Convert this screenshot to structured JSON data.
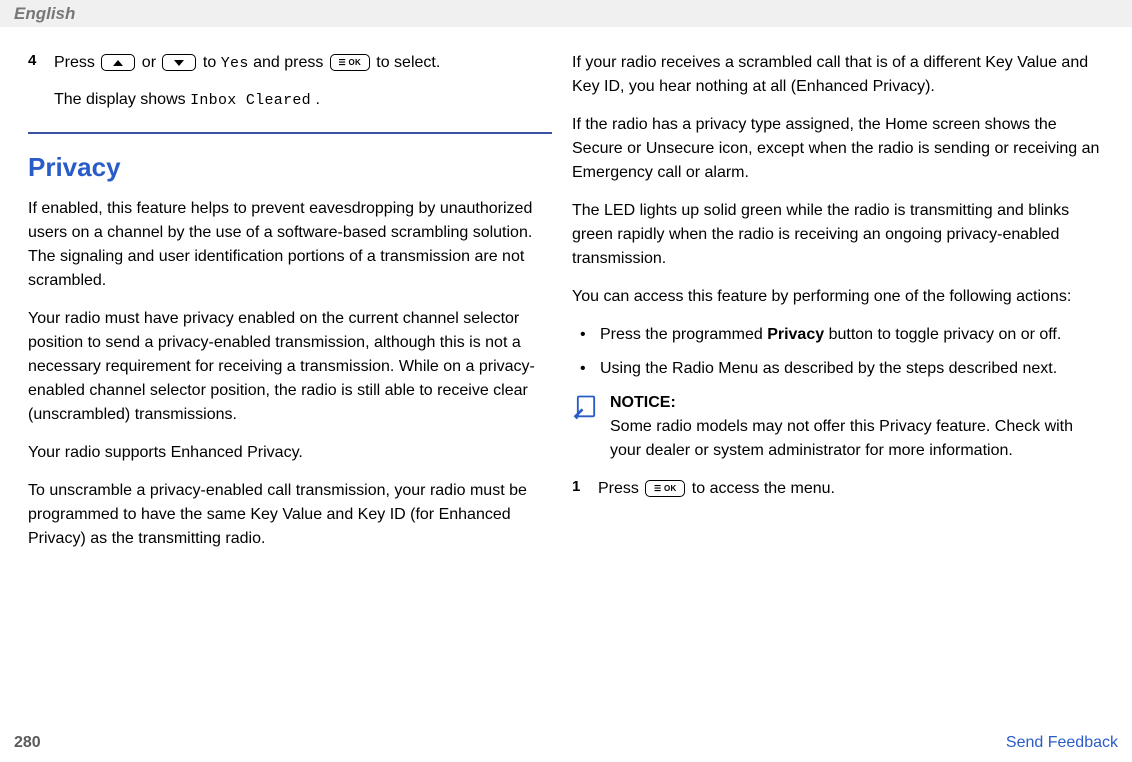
{
  "header": {
    "language": "English"
  },
  "left": {
    "step4": {
      "num": "4",
      "line1_a": "Press ",
      "line1_b": " or ",
      "line1_c": " to ",
      "yes": "Yes",
      "line1_d": " and press ",
      "line1_e": " to select.",
      "line2_a": "The display shows ",
      "inbox_cleared": "Inbox Cleared",
      "line2_b": "."
    },
    "privacy_heading": "Privacy",
    "p1": "If enabled, this feature helps to prevent eavesdropping by unauthorized users on a channel by the use of a software-based scrambling solution. The signaling and user identification portions of a transmission are not scrambled.",
    "p2": "Your radio must have privacy enabled on the current channel selector position to send a privacy-enabled transmission, although this is not a necessary requirement for receiving a transmission. While on a privacy-enabled channel selector position, the radio is still able to receive clear (unscrambled) transmissions.",
    "p3": "Your radio supports Enhanced Privacy.",
    "p4": "To unscramble a privacy-enabled call transmission, your radio must be programmed to have the same Key Value and Key ID (for Enhanced Privacy) as the transmitting radio."
  },
  "right": {
    "p1": "If your radio receives a scrambled call that is of a different Key Value and Key ID, you hear nothing at all (Enhanced Privacy).",
    "p2": "If the radio has a privacy type assigned, the Home screen shows the Secure or Unsecure icon, except when the radio is sending or receiving an Emergency call or alarm.",
    "p3": "The LED lights up solid green while the radio is transmitting and blinks green rapidly when the radio is receiving an ongoing privacy-enabled transmission.",
    "p4": "You can access this feature by performing one of the following actions:",
    "bullet1_a": "Press the programmed ",
    "bullet1_bold": "Privacy",
    "bullet1_b": " button to toggle privacy on or off.",
    "bullet2": "Using the Radio Menu as described by the steps described next.",
    "notice_title": "NOTICE:",
    "notice_body": "Some radio models may not offer this Privacy feature. Check with your dealer or system administrator for more information.",
    "step1": {
      "num": "1",
      "a": "Press ",
      "b": " to access the menu."
    }
  },
  "icons": {
    "ok_label": "☰ OK"
  },
  "footer": {
    "page": "280",
    "feedback": "Send Feedback"
  }
}
